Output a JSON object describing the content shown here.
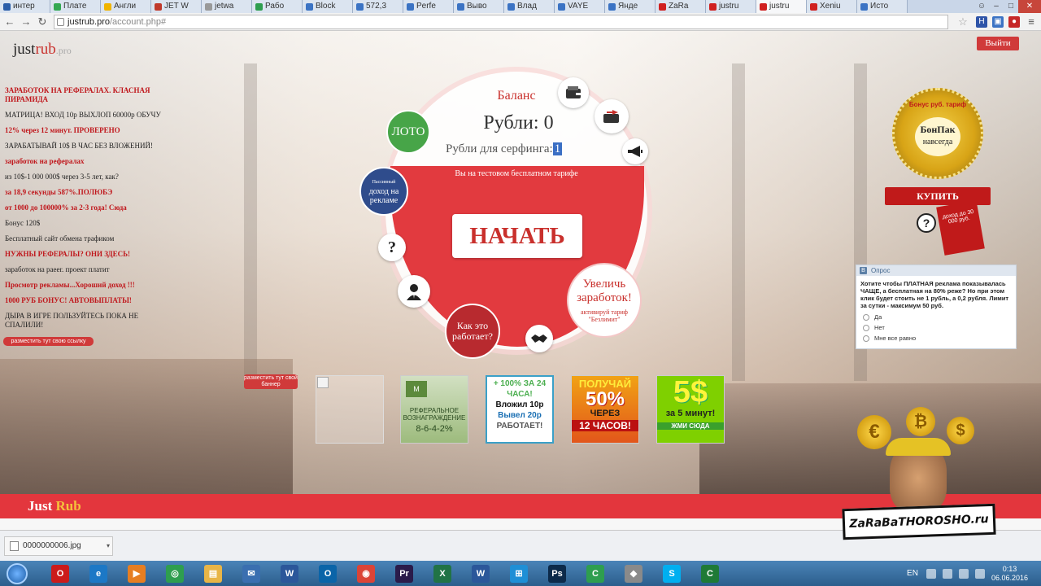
{
  "browser": {
    "tabs": [
      {
        "label": "интер",
        "color": "#2a5da8"
      },
      {
        "label": "Плате",
        "color": "#33a852"
      },
      {
        "label": "Англи",
        "color": "#f0b400"
      },
      {
        "label": "JET W",
        "color": "#c0392b"
      },
      {
        "label": "jetwa",
        "color": "#999999"
      },
      {
        "label": "Рабо",
        "color": "#2e9e4f"
      },
      {
        "label": "Block",
        "color": "#3b73c4"
      },
      {
        "label": "572,3",
        "color": "#3b73c4"
      },
      {
        "label": "Perfe",
        "color": "#3b73c4"
      },
      {
        "label": "Выво",
        "color": "#3b73c4"
      },
      {
        "label": "Влад",
        "color": "#3b73c4"
      },
      {
        "label": "VAYE",
        "color": "#3b73c4"
      },
      {
        "label": "Янде",
        "color": "#3b73c4"
      },
      {
        "label": "ZaRa",
        "color": "#d02020"
      },
      {
        "label": "justru",
        "color": "#d02020"
      },
      {
        "label": "justru",
        "color": "#d02020",
        "active": true
      },
      {
        "label": "Xeniu",
        "color": "#d02020"
      },
      {
        "label": "Исто",
        "color": "#3b73c4"
      }
    ],
    "url_host": "justrub.pro",
    "url_path": "/account.php#"
  },
  "site": {
    "logo_main": "just",
    "logo_accent": "rub",
    "logo_suffix": ".pro",
    "logout": "Выйти"
  },
  "links": [
    {
      "text": "ЗАРАБОТОК НА РЕФЕРАЛАХ. КЛАСНАЯ ПИРАМИДА",
      "red": true
    },
    {
      "text": "МАТРИЦА! ВХОД 10р ВЫХЛОП 60000р ОБУЧУ",
      "red": false
    },
    {
      "text": "12% через 12 минут. ПРОВЕРЕНО",
      "red": true
    },
    {
      "text": "ЗАРАБАТЫВАЙ 10$ В ЧАС БЕЗ ВЛОЖЕНИЙ!",
      "red": false
    },
    {
      "text": "заработок на рефералах",
      "red": true
    },
    {
      "text": "из 10$-1 000 000$ через 3-5 лет, как?",
      "red": false
    },
    {
      "text": "за 18,9 секунды 587%.ПОЛЮБЭ",
      "red": true
    },
    {
      "text": "от 1000 до 100000% за 2-3 года! Сюда",
      "red": true
    },
    {
      "text": "Бонус 120$",
      "red": false
    },
    {
      "text": "Бесплатный сайт обмена трафиком",
      "red": false
    },
    {
      "text": "НУЖНЫ РЕФЕРАЛЫ? ОНИ ЗДЕСЬ!",
      "red": true
    },
    {
      "text": "заработок на paeer. проект платит",
      "red": false
    },
    {
      "text": "Просмотр рекламы...Хороший доход !!!",
      "red": true
    },
    {
      "text": "1000 РУБ БОНУС! АВТОВЫПЛАТЫ!",
      "red": true
    },
    {
      "text": "ДЫРА В ИГРЕ ПОЛЬЗУЙТЕСЬ ПОКА НЕ СПАЛИЛИ!",
      "red": false
    }
  ],
  "place_link": "разместить тут свою ссылку",
  "widget": {
    "balance_title": "Баланс",
    "rub_label": "Рубли:",
    "rub_value": "0",
    "surf_label": "Рубли для серфинга:",
    "surf_value": "1",
    "tariff_note": "Вы на тестовом бесплатном тарифе",
    "start": "НАЧАТЬ",
    "loto": "ЛОТО",
    "passive_small": "Пассивный",
    "passive_main": "доход на рекламе",
    "help": "?",
    "how_works": "Как это работает?",
    "increase_big": "Увеличь заработок!",
    "increase_small": "активируй тариф \"Безлимит\""
  },
  "badge": {
    "top": "Бонус руб. тариф",
    "name": "БонПак",
    "sub": "навсегда",
    "buy": "КУПИТЬ",
    "tail": "доход до 30 000 руб.",
    "q": "?"
  },
  "poll": {
    "title": "Опрос",
    "question": "Хотите чтобы ПЛАТНАЯ реклама показывалась ЧАЩЕ, а бесплатная на 80% реже? Но при этом клик будет стоить не 1 рубль, а 0,2 рубля. Лимит за сутки - максимум 50 руб.",
    "options": [
      "Да",
      "Нет",
      "Мне все равно"
    ]
  },
  "place_banner": "разместить тут свой баннер",
  "banners": {
    "referral_logo": "M",
    "referral_text": "РЕФЕРАЛЬНОЕ ВОЗНАГРАЖДЕНИЕ",
    "referral_nums": "8-6-4-2%",
    "deposit_1": "+ 100% ЗА 24",
    "deposit_2": "ЧАСА!",
    "deposit_3": "Вложил 10р",
    "deposit_4": "Вывел 20р",
    "deposit_5": "РАБОТАЕТ!",
    "fifty_1": "ПОЛУЧАЙ",
    "fifty_2": "50%",
    "fifty_3": "ЧЕРЕЗ",
    "fifty_4": "12 ЧАСОВ!",
    "five_1": "5$",
    "five_2": "за 5 минут!",
    "five_3": "ЖМИ СЮДА"
  },
  "footer": {
    "logo_a": "Just",
    "logo_b": "Rub"
  },
  "watermark": "ZaRaBaTHOROSHO.ru",
  "downloads": {
    "file": "0000000006.jpg"
  },
  "taskbar": {
    "apps": [
      {
        "name": "opera",
        "label": "O",
        "color": "#cc1b1b"
      },
      {
        "name": "ie",
        "label": "e",
        "color": "#1c78c6"
      },
      {
        "name": "media-player",
        "label": "▶",
        "color": "#e67e22"
      },
      {
        "name": "network",
        "label": "◎",
        "color": "#2e9e4f"
      },
      {
        "name": "explorer",
        "label": "▤",
        "color": "#e8b547"
      },
      {
        "name": "mail",
        "label": "✉",
        "color": "#3a6fb0"
      },
      {
        "name": "word",
        "label": "W",
        "color": "#2b579a"
      },
      {
        "name": "outlook",
        "label": "O",
        "color": "#0a64a8"
      },
      {
        "name": "chrome",
        "label": "◉",
        "color": "#db4437"
      },
      {
        "name": "premiere",
        "label": "Pr",
        "color": "#2a1b4a"
      },
      {
        "name": "excel",
        "label": "X",
        "color": "#217346"
      },
      {
        "name": "word2",
        "label": "W",
        "color": "#2b579a"
      },
      {
        "name": "windows",
        "label": "⊞",
        "color": "#1e8fd6"
      },
      {
        "name": "photoshop",
        "label": "Ps",
        "color": "#0c2a4a"
      },
      {
        "name": "camtasia",
        "label": "C",
        "color": "#2e9e4f"
      },
      {
        "name": "app",
        "label": "◆",
        "color": "#8a8a8a"
      },
      {
        "name": "skype",
        "label": "S",
        "color": "#00aff0"
      },
      {
        "name": "camtasia2",
        "label": "C",
        "color": "#1f7a36"
      }
    ],
    "lang": "EN",
    "time": "0:13",
    "date": "06.06.2016"
  }
}
